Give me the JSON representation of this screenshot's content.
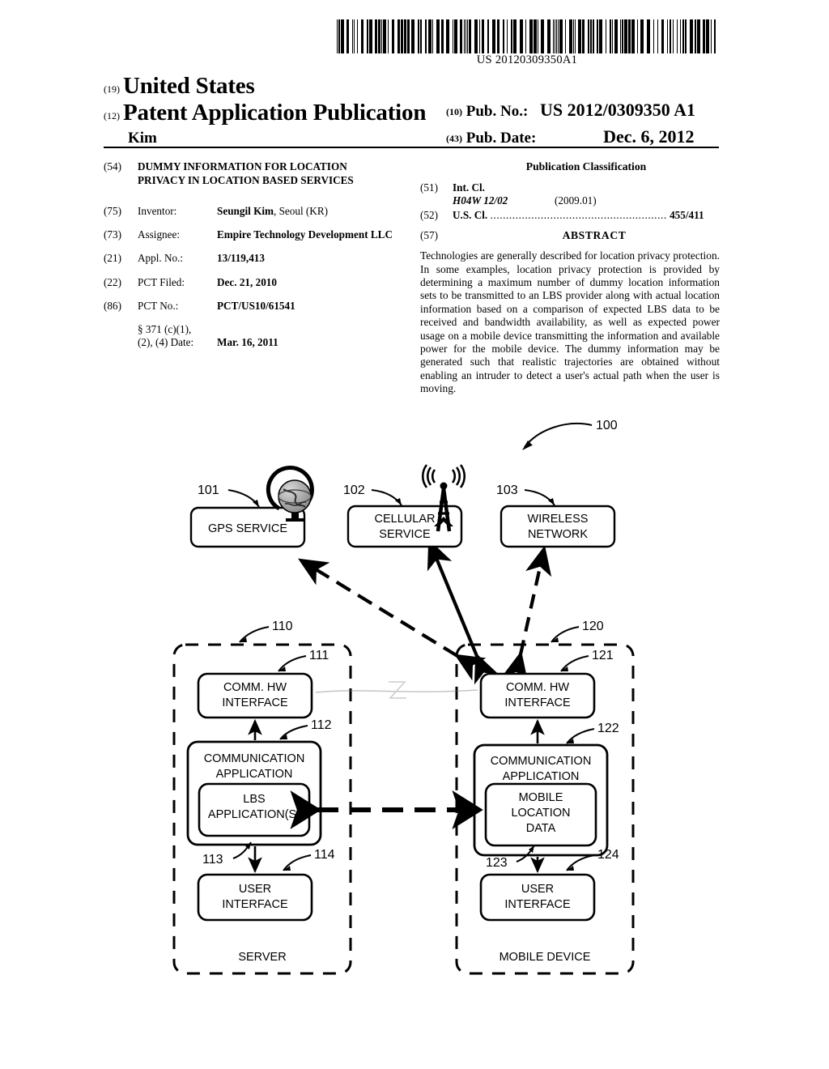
{
  "barcode": {
    "number": "US 20120309350A1"
  },
  "header": {
    "code_19": "(19)",
    "country": "United States",
    "code_12": "(12)",
    "doc_type": "Patent Application Publication",
    "author": "Kim",
    "code_10": "(10)",
    "pub_no_label": "Pub. No.:",
    "pub_no_value": "US 2012/0309350 A1",
    "code_43": "(43)",
    "pub_date_label": "Pub. Date:",
    "pub_date_value": "Dec. 6, 2012"
  },
  "biblio": {
    "title_code": "(54)",
    "title_line1": "DUMMY INFORMATION FOR LOCATION",
    "title_line2": "PRIVACY IN LOCATION BASED SERVICES",
    "rows": [
      {
        "code": "(75)",
        "label": "Inventor:",
        "value_bold": "Seungil Kim",
        "value_rest": ", Seoul (KR)"
      },
      {
        "code": "(73)",
        "label": "Assignee:",
        "value_bold": "Empire Technology Development LLC",
        "value_rest": ""
      },
      {
        "code": "(21)",
        "label": "Appl. No.:",
        "value_bold": "13/119,413",
        "value_rest": ""
      },
      {
        "code": "(22)",
        "label": "PCT Filed:",
        "value_bold": "Dec. 21, 2010",
        "value_rest": ""
      },
      {
        "code": "(86)",
        "label": "PCT No.:",
        "value_bold": "PCT/US10/61541",
        "value_rest": ""
      }
    ],
    "sec371_line1": "§ 371 (c)(1),",
    "sec371_line2": "(2), (4) Date:",
    "sec371_value": "Mar. 16, 2011"
  },
  "classification": {
    "heading": "Publication Classification",
    "int_cl_code": "(51)",
    "int_cl_label": "Int. Cl.",
    "int_cl_value": "H04W 12/02",
    "int_cl_version": "(2009.01)",
    "us_cl_code": "(52)",
    "us_cl_label": "U.S. Cl.",
    "us_cl_leader": "........................................................",
    "us_cl_value": "455/411",
    "abstract_code": "(57)",
    "abstract_heading": "ABSTRACT",
    "abstract_text": "Technologies are generally described for location privacy protection. In some examples, location privacy protection is provided by determining a maximum number of dummy location information sets to be transmitted to an LBS provider along with actual location information based on a comparison of expected LBS data to be received and bandwidth availability, as well as expected power usage on a mobile device transmitting the information and available power for the mobile device. The dummy information may be generated such that realistic trajectories are obtained without enabling an intruder to detect a user's actual path when the user is moving."
  },
  "figure": {
    "system_ref": "100",
    "services": [
      {
        "ref": "101",
        "label_line1": "GPS SERVICE",
        "label_line2": "",
        "icon": "globe-icon"
      },
      {
        "ref": "102",
        "label_line1": "CELLULAR",
        "label_line2": "SERVICE",
        "icon": "cell-tower-icon"
      },
      {
        "ref": "103",
        "label_line1": "WIRELESS",
        "label_line2": "NETWORK",
        "icon": ""
      }
    ],
    "server": {
      "ref": "110",
      "footer_label": "SERVER",
      "comm_hw_ref": "111",
      "comm_hw_line1": "COMM. HW",
      "comm_hw_line2": "INTERFACE",
      "comm_app_ref": "112",
      "comm_app_line1": "COMMUNICATION",
      "comm_app_line2": "APPLICATION",
      "inner_ref": "113",
      "inner_line1": "LBS",
      "inner_line2": "APPLICATION(S)",
      "inner_line3": "",
      "user_if_ref": "114",
      "user_if_line1": "USER",
      "user_if_line2": "INTERFACE"
    },
    "mobile": {
      "ref": "120",
      "footer_label": "MOBILE DEVICE",
      "comm_hw_ref": "121",
      "comm_hw_line1": "COMM. HW",
      "comm_hw_line2": "INTERFACE",
      "comm_app_ref": "122",
      "comm_app_line1": "COMMUNICATION",
      "comm_app_line2": "APPLICATION",
      "inner_ref": "123",
      "inner_line1": "MOBILE",
      "inner_line2": "LOCATION",
      "inner_line3": "DATA",
      "user_if_ref": "124",
      "user_if_line1": "USER",
      "user_if_line2": "INTERFACE"
    }
  },
  "colors": {
    "ink": "#000000",
    "paper": "#ffffff"
  }
}
